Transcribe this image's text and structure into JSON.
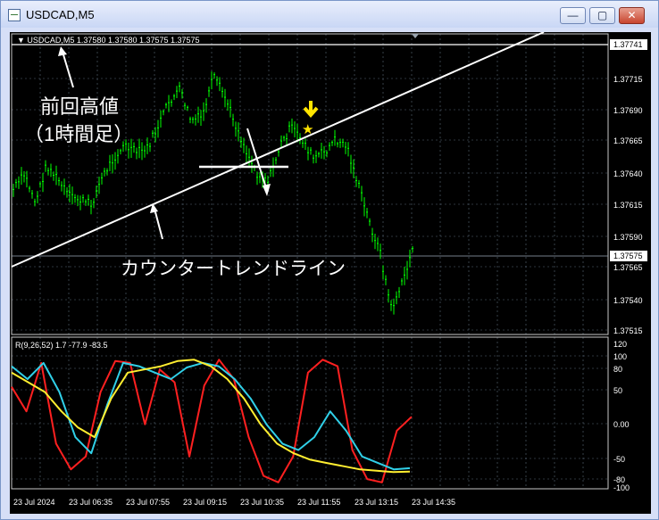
{
  "window": {
    "title": "USDCAD,M5",
    "buttons": {
      "minimize": "—",
      "maximize": "▢",
      "close": "✕"
    }
  },
  "price_panel": {
    "header": "▼ USDCAD,M5   1.37580 1.37580 1.37575 1.37575",
    "price_ticks": [
      "1.37715",
      "1.37690",
      "1.37665",
      "1.37640",
      "1.37615",
      "1.37590",
      "1.37565",
      "1.37540",
      "1.37515"
    ],
    "high_line_label": "1.37741",
    "current_price_label": "1.37575",
    "annotations": {
      "prev_high": "前回高値",
      "prev_high_sub": "（1時間足）",
      "counter_trendline": "カウンタートレンドライン"
    }
  },
  "indicator_panel": {
    "header": "R(9,26,52) 1.7 -77.9 -83.5",
    "ticks": [
      "120",
      "100",
      "80",
      "50",
      "0.00",
      "-50",
      "-80",
      "-100"
    ]
  },
  "time_axis": [
    "23 Jul 2024",
    "23 Jul 06:35",
    "23 Jul 07:55",
    "23 Jul 09:15",
    "23 Jul 10:35",
    "23 Jul 11:55",
    "23 Jul 13:15",
    "23 Jul 14:35"
  ],
  "colors": {
    "background": "#000000",
    "candle": "#00ff00",
    "grid": "#5a6a7a",
    "annotation": "#ffffff",
    "star": "#ffe400",
    "rsi_fast": "#ff2020",
    "rsi_mid": "#30d0e8",
    "rsi_slow": "#ffee30"
  },
  "chart_data": {
    "type": "line",
    "symbol": "USDCAD",
    "timeframe": "M5",
    "price_ylim": [
      1.37505,
      1.37745
    ],
    "close": [
      1.3762,
      1.37632,
      1.3761,
      1.3764,
      1.37628,
      1.37615,
      1.37612,
      1.37608,
      1.3763,
      1.37645,
      1.37655,
      1.3765,
      1.37652,
      1.3767,
      1.3769,
      1.377,
      1.37675,
      1.37678,
      1.3771,
      1.37695,
      1.37672,
      1.3765,
      1.37632,
      1.37628,
      1.37655,
      1.3767,
      1.3766,
      1.37645,
      1.3765,
      1.3766,
      1.37655,
      1.37625,
      1.37595,
      1.3757,
      1.37525,
      1.37545,
      1.37575
    ],
    "indicator_ylim": [
      -110,
      125
    ],
    "series": [
      {
        "name": "R(9)",
        "values": [
          48,
          10,
          85,
          -40,
          -80,
          -60,
          40,
          88,
          85,
          -10,
          75,
          55,
          -60,
          50,
          90,
          60,
          -30,
          -90,
          -100,
          -60,
          70,
          90,
          80,
          -50,
          -95,
          -100,
          -20,
          1.7
        ]
      },
      {
        "name": "R(26)",
        "values": [
          80,
          60,
          85,
          40,
          -30,
          -55,
          20,
          85,
          80,
          70,
          60,
          78,
          85,
          80,
          60,
          30,
          -10,
          -40,
          -50,
          -30,
          10,
          -20,
          -60,
          -70,
          -80,
          -78
        ]
      },
      {
        "name": "R(52)",
        "values": [
          70,
          55,
          40,
          10,
          -15,
          -30,
          30,
          70,
          75,
          80,
          88,
          90,
          80,
          60,
          30,
          -10,
          -40,
          -55,
          -65,
          -70,
          -75,
          -80,
          -82,
          -84,
          -83.5
        ]
      }
    ]
  }
}
